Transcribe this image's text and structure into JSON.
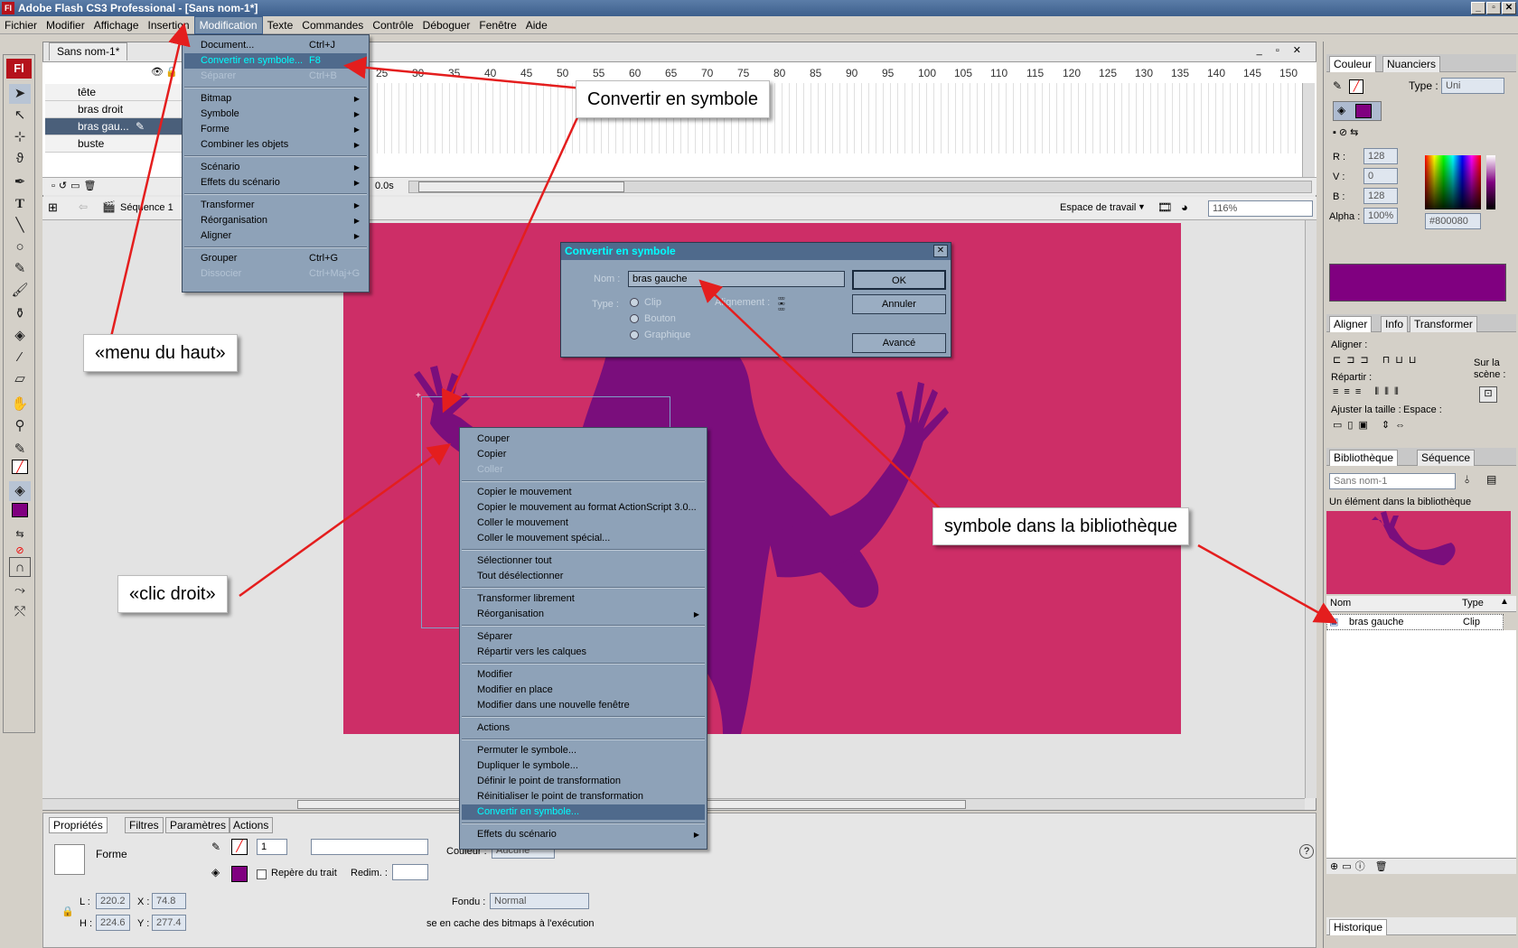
{
  "window": {
    "title": "Adobe Flash CS3 Professional - [Sans nom-1*]",
    "app_icon": "Fl"
  },
  "menubar": [
    "Fichier",
    "Modifier",
    "Affichage",
    "Insertion",
    "Modification",
    "Texte",
    "Commandes",
    "Contrôle",
    "Déboguer",
    "Fenêtre",
    "Aide"
  ],
  "document": {
    "tab": "Sans nom-1*",
    "layers": [
      "tête",
      "bras droit",
      "bras gau...",
      "buste"
    ],
    "ruler_ticks": [
      "25",
      "30",
      "35",
      "40",
      "45",
      "50",
      "55",
      "60",
      "65",
      "70",
      "75",
      "80",
      "85",
      "90",
      "95",
      "100",
      "105",
      "110",
      "115",
      "120",
      "125",
      "130",
      "135",
      "140",
      "145",
      "150"
    ],
    "timeline_time": "0.0s",
    "scene": "Séquence 1",
    "workspace": "Espace de travail",
    "zoom": "116%"
  },
  "modification_menu": {
    "items": [
      {
        "label": "Document...",
        "shortcut": "Ctrl+J"
      },
      {
        "label": "Convertir en symbole...",
        "shortcut": "F8",
        "highlighted": true
      },
      {
        "label": "Séparer",
        "shortcut": "Ctrl+B",
        "disabled": true
      },
      {
        "label": "Bitmap",
        "submenu": true
      },
      {
        "label": "Symbole",
        "submenu": true
      },
      {
        "label": "Forme",
        "submenu": true
      },
      {
        "label": "Combiner les objets",
        "submenu": true
      },
      {
        "label": "Scénario",
        "submenu": true
      },
      {
        "label": "Effets du scénario",
        "submenu": true
      },
      {
        "label": "Transformer",
        "submenu": true
      },
      {
        "label": "Réorganisation",
        "submenu": true
      },
      {
        "label": "Aligner",
        "submenu": true
      },
      {
        "label": "Grouper",
        "shortcut": "Ctrl+G"
      },
      {
        "label": "Dissocier",
        "shortcut": "Ctrl+Maj+G",
        "disabled": true
      }
    ]
  },
  "dialog": {
    "title": "Convertir en symbole",
    "name_label": "Nom :",
    "name_value": "bras gauche",
    "type_label": "Type :",
    "types": [
      "Clip",
      "Bouton",
      "Graphique"
    ],
    "alignment_label": "Alignement :",
    "ok": "OK",
    "cancel": "Annuler",
    "advanced": "Avancé"
  },
  "context_menu": {
    "items": [
      "Couper",
      "Copier",
      "Coller",
      "—",
      "Copier le mouvement",
      "Copier le mouvement au format ActionScript 3.0...",
      "Coller le mouvement",
      "Coller le mouvement spécial...",
      "—",
      "Sélectionner tout",
      "Tout désélectionner",
      "—",
      "Transformer librement",
      "Réorganisation",
      "—",
      "Séparer",
      "Répartir vers les calques",
      "—",
      "Modifier",
      "Modifier en place",
      "Modifier dans une nouvelle fenêtre",
      "—",
      "Actions",
      "—",
      "Permuter le symbole...",
      "Dupliquer le symbole...",
      "Définir le point de transformation",
      "Réinitialiser le point de transformation",
      "Convertir en symbole...",
      "—",
      "Effets du scénario"
    ],
    "disabled": [
      "Coller"
    ],
    "submenus": [
      "Réorganisation",
      "Effets du scénario"
    ],
    "highlighted": "Convertir en symbole..."
  },
  "properties": {
    "tabs": [
      "Propriétés",
      "Filtres",
      "Paramètres",
      "Actions"
    ],
    "object_type": "Forme",
    "stroke_width": "1",
    "stroke_hint": "Repère du trait",
    "redim_label": "Redim. :",
    "color_label": "Couleur :",
    "color_value": "Aucune",
    "blend_label": "Fondu :",
    "blend_value": "Normal",
    "cache_text": "se en cache des bitmaps à l'exécution",
    "L": "220.2",
    "H": "224.6",
    "X": "74.8",
    "Y": "277.4"
  },
  "color_panel": {
    "tabs": [
      "Couleur",
      "Nuanciers"
    ],
    "type_label": "Type :",
    "type_value": "Uni",
    "R": "128",
    "V": "0",
    "B": "128",
    "alpha": "100%",
    "hex": "#800080",
    "fill_color": "#800080"
  },
  "align_panel": {
    "tabs": [
      "Aligner",
      "Info",
      "Transformer"
    ],
    "align_label": "Aligner :",
    "distribute_label": "Répartir :",
    "match_label": "Ajuster la taille :",
    "space_label": "Espace :",
    "stage_label": "Sur la scène :"
  },
  "library_panel": {
    "tabs": [
      "Bibliothèque",
      "Séquence"
    ],
    "document": "Sans nom-1",
    "count_text": "Un élément dans la bibliothèque",
    "col_name": "Nom",
    "col_type": "Type",
    "items": [
      {
        "name": "bras gauche",
        "type": "Clip"
      }
    ]
  },
  "history_panel": {
    "tab": "Historique"
  },
  "annotations": {
    "menu_haut": "«menu du haut»",
    "convertir": "Convertir en symbole",
    "clic_droit": "«clic droit»",
    "symbole_biblio": "symbole dans la bibliothèque"
  },
  "colors": {
    "stage": "#cd2e67",
    "silhouette": "#7a0e7c",
    "menu_bg": "#8ea2b8",
    "highlight": "#4f6a8c",
    "arrow": "#e41e1e"
  }
}
